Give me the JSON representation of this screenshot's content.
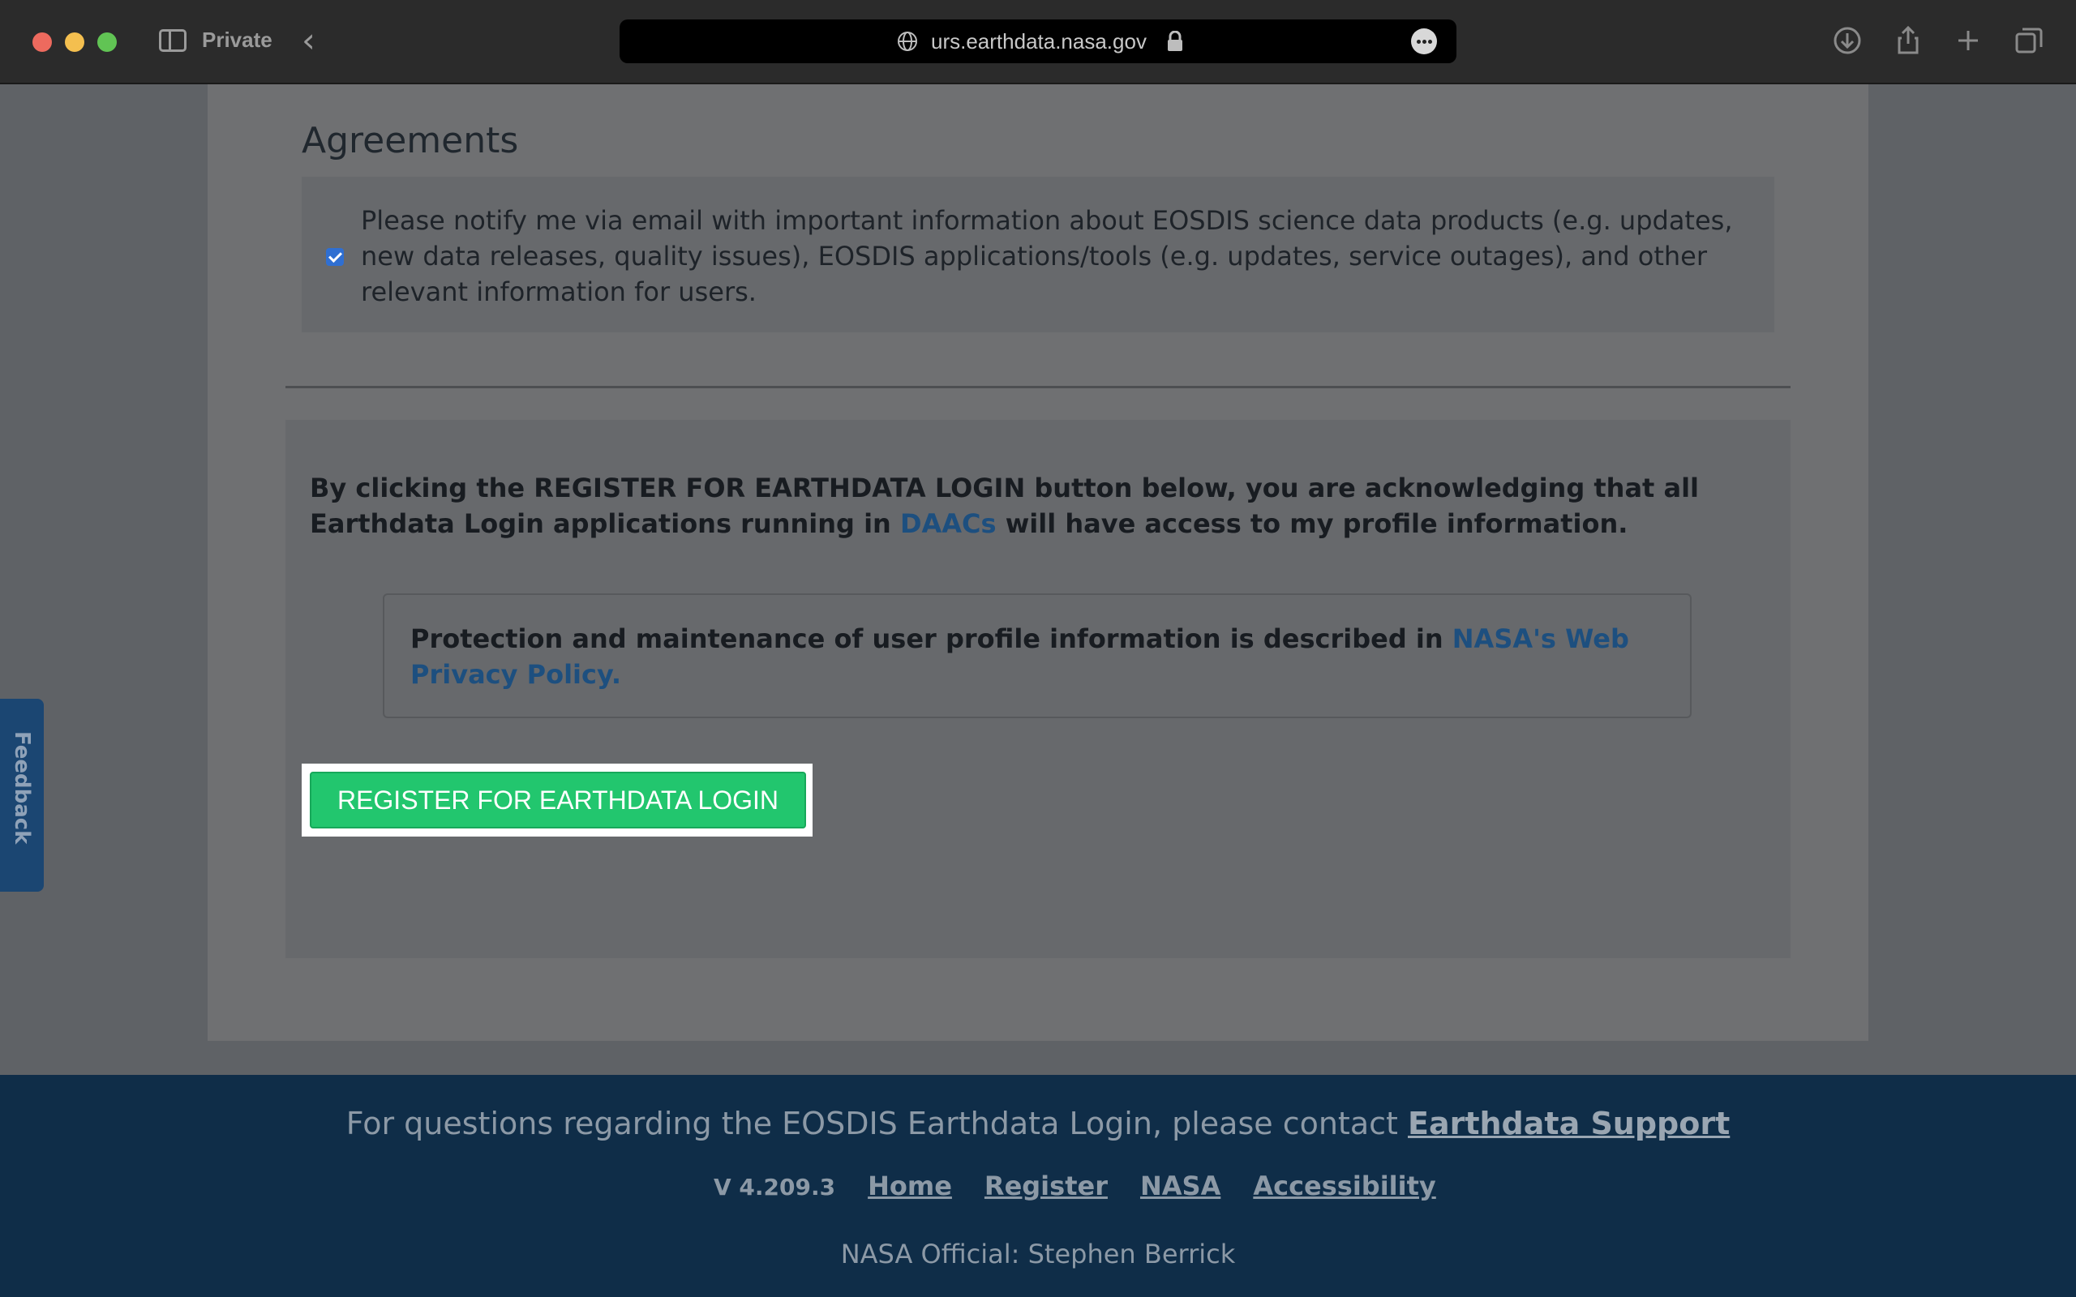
{
  "browser": {
    "private_label": "Private",
    "url": "urs.earthdata.nasa.gov"
  },
  "agreements": {
    "title": "Agreements",
    "notify_text": "Please notify me via email with important information about EOSDIS science data products (e.g. updates, new data releases, quality issues), EOSDIS applications/tools (e.g. updates, service outages), and other relevant information for users.",
    "notify_checked": true
  },
  "register": {
    "ack_text_before": "By clicking the REGISTER FOR EARTHDATA LOGIN button below, you are acknowledging that all Earthdata Login applications running in ",
    "ack_link": "DAACs",
    "ack_text_after": " will have access to my profile information.",
    "privacy_text": "Protection and maintenance of user profile information is described in ",
    "privacy_link": "NASA's Web Privacy Policy.",
    "button_label": "REGISTER FOR EARTHDATA LOGIN"
  },
  "feedback_label": "Feedback",
  "footer": {
    "contact_text": "For questions regarding the EOSDIS Earthdata Login, please contact ",
    "contact_link": "Earthdata Support",
    "version": "V 4.209.3",
    "links": [
      "Home",
      "Register",
      "NASA",
      "Accessibility"
    ],
    "official": "NASA Official: Stephen Berrick"
  },
  "colors": {
    "register_button": "#22c66e",
    "link": "#1d4f7f",
    "footer_bg": "#0f2d48"
  }
}
